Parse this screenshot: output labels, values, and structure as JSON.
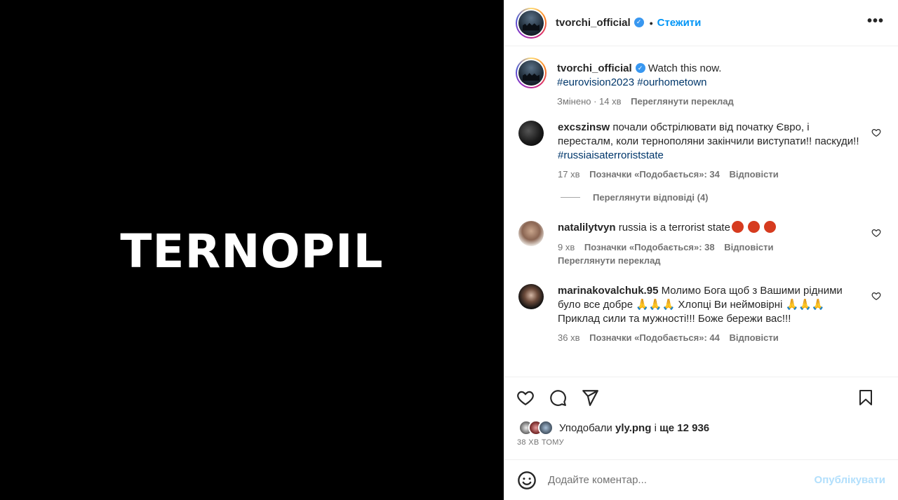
{
  "media": {
    "text": "TERNOPIL"
  },
  "header": {
    "username": "tvorchi_official",
    "follow_label": "Стежити",
    "more_label": "•••"
  },
  "caption": {
    "username": "tvorchi_official",
    "text": "Watch this now.",
    "tag1": "#eurovision2023",
    "tag2": "#ourhometown",
    "edited_label": "Змінено · 14 хв",
    "translate_label": "Переглянути переклад"
  },
  "comments": [
    {
      "username": "excszinsw",
      "text": "почали обстрілювати від початку Євро, і перестaлм, коли тернополяни закінчили виступати!! паскуди!!",
      "tag": "#russiaisaterroriststate",
      "time": "17 хв",
      "likes": "Позначки «Подобається»: 34",
      "reply": "Відповісти",
      "view_replies": "Переглянути відповіді (4)"
    },
    {
      "username": "natalilytvyn",
      "text": "russia is a terrorist state",
      "time": "9 хв",
      "likes": "Позначки «Подобається»: 38",
      "reply": "Відповісти",
      "translate": "Переглянути переклад"
    },
    {
      "username": "marinakovalchuk.95",
      "text1": "Молимо Бога щоб з Вашими рідними було все добре",
      "text2": "Хлопці Ви неймовірні",
      "text3": "Приклад сили та мужності!!! Боже бережи вас!!!",
      "time": "36 хв",
      "likes": "Позначки «Подобається»: 44",
      "reply": "Відповісти"
    }
  ],
  "likes": {
    "prefix": "Уподобали",
    "user": "yly.png",
    "middle": "і",
    "rest": "ще 12 936"
  },
  "time_ago": "38 ХВ ТОМУ",
  "composer": {
    "placeholder": "Додайте коментар...",
    "publish_label": "Опублікувати"
  },
  "colors": {
    "accent": "#0095f6",
    "publish_disabled": "#b2dffc",
    "link": "#00376b"
  }
}
